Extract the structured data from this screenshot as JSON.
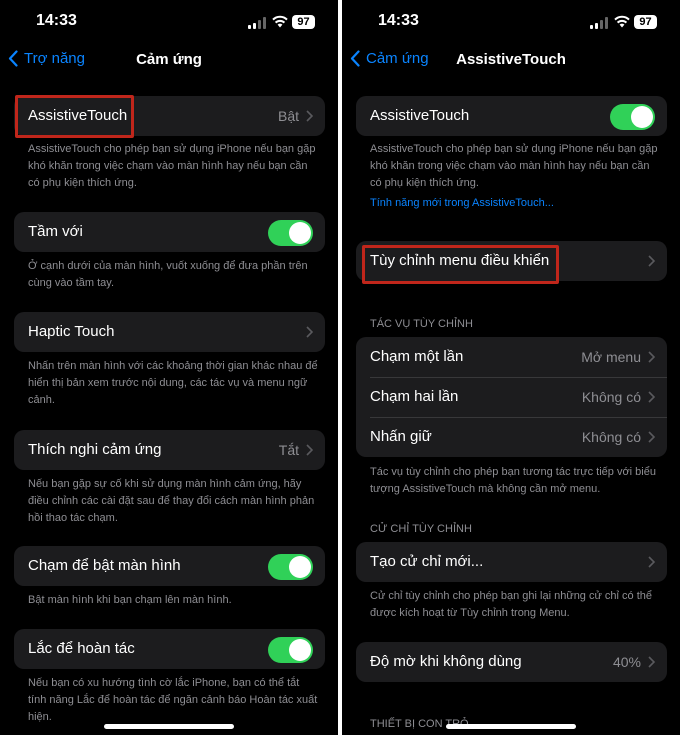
{
  "status": {
    "time": "14:33",
    "battery": "97"
  },
  "left": {
    "nav": {
      "back": "Trợ năng",
      "title": "Cảm ứng"
    },
    "assistive": {
      "label": "AssistiveTouch",
      "value": "Bật",
      "desc": "AssistiveTouch cho phép bạn sử dụng iPhone nếu bạn gặp khó khăn trong việc chạm vào màn hình hay nếu bạn cần có phụ kiện thích ứng."
    },
    "reach": {
      "label": "Tầm với",
      "desc": "Ở cạnh dưới của màn hình, vuốt xuống để đưa phần trên cùng vào tầm tay."
    },
    "haptic": {
      "label": "Haptic Touch",
      "desc": "Nhấn trên màn hình với các khoảng thời gian khác nhau để hiển thị bản xem trước nội dung, các tác vụ và menu ngữ cảnh."
    },
    "accommodations": {
      "label": "Thích nghi cảm ứng",
      "value": "Tắt",
      "desc": "Nếu bạn gặp sự cố khi sử dụng màn hình cảm ứng, hãy điều chỉnh các cài đặt sau để thay đổi cách màn hình phản hồi thao tác chạm."
    },
    "tapwake": {
      "label": "Chạm để bật màn hình",
      "desc": "Bật màn hình khi bạn chạm lên màn hình."
    },
    "shake": {
      "label": "Lắc để hoàn tác",
      "desc": "Nếu bạn có xu hướng tình cờ lắc iPhone, bạn có thể tắt tính năng Lắc để hoàn tác để ngăn cảnh báo Hoàn tác xuất hiện."
    }
  },
  "right": {
    "nav": {
      "back": "Cảm ứng",
      "title": "AssistiveTouch"
    },
    "assistive": {
      "label": "AssistiveTouch",
      "desc": "AssistiveTouch cho phép bạn sử dụng iPhone nếu bạn gặp khó khăn trong việc chạm vào màn hình hay nếu bạn cần có phụ kiện thích ứng.",
      "link": "Tính năng mới trong AssistiveTouch..."
    },
    "customize": {
      "label": "Tùy chỉnh menu điều khiển"
    },
    "custom_actions": {
      "header": "TÁC VỤ TÙY CHỈNH",
      "rows": [
        {
          "label": "Chạm một lần",
          "value": "Mở menu"
        },
        {
          "label": "Chạm hai lần",
          "value": "Không có"
        },
        {
          "label": "Nhấn giữ",
          "value": "Không có"
        }
      ],
      "desc": "Tác vụ tùy chỉnh cho phép bạn tương tác trực tiếp với biểu tượng AssistiveTouch mà không cần mở menu."
    },
    "custom_gestures": {
      "header": "CỬ CHỈ TÙY CHỈNH",
      "create": "Tạo cử chỉ mới...",
      "desc": "Cử chỉ tùy chỉnh cho phép bạn ghi lại những cử chỉ có thể được kích hoạt từ Tùy chỉnh trong Menu."
    },
    "idle": {
      "label": "Độ mờ khi không dùng",
      "value": "40%"
    },
    "pointer_header": "THIẾT BỊ CON TRỎ"
  },
  "colors": {
    "accent": "#0a84ff",
    "toggle_on": "#30d158",
    "highlight": "#c0261b",
    "cell": "#1c1c1e"
  },
  "icons": [
    "back-chevron-icon",
    "chevron-right-icon",
    "wifi-icon",
    "signal-icon",
    "battery-icon"
  ]
}
